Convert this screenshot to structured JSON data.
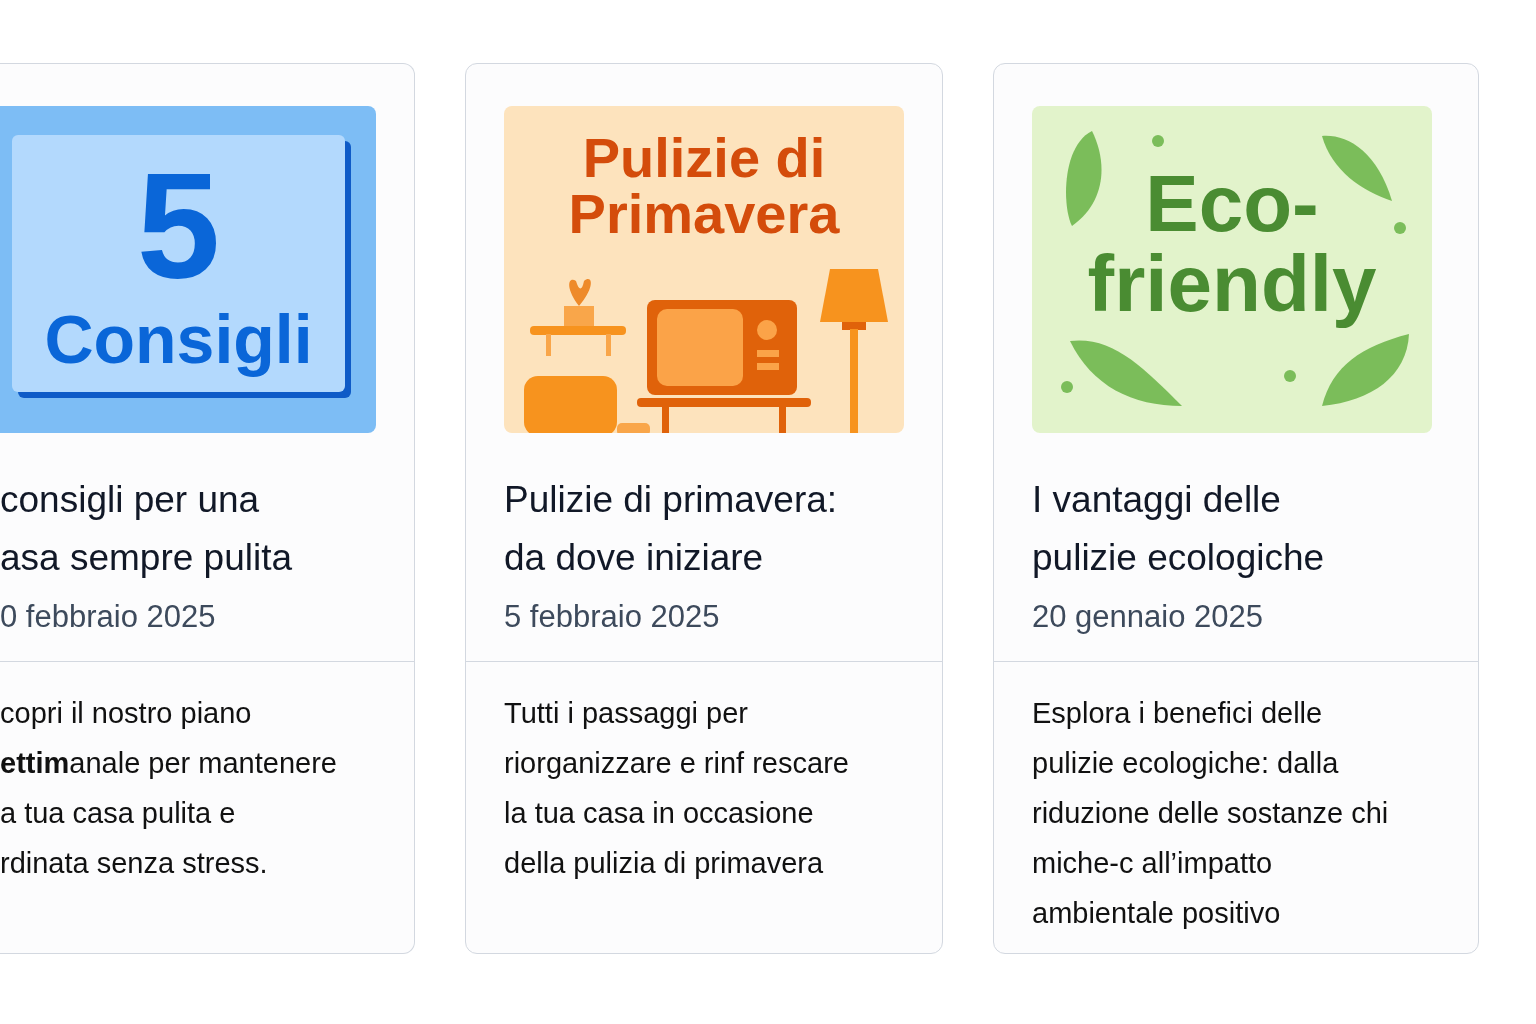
{
  "cards": [
    {
      "image": {
        "kind": "numbers",
        "text_lines": [
          "5",
          "Consigli"
        ]
      },
      "title_lines": [
        "consigli per una",
        "asa sempre pulita"
      ],
      "date": "0 febbraio 2025",
      "description_lines": [
        "copri il nostro piano",
        "**ettim**anale per mantenere",
        "a tua casa pulita e",
        "rdinata senza stress."
      ]
    },
    {
      "image": {
        "kind": "spring",
        "text_lines": [
          "Pulizie di",
          "Primavera"
        ]
      },
      "title_lines": [
        "Pulizie di primavera:",
        "da dove iniziare"
      ],
      "date": "5 febbraio 2025",
      "description_lines": [
        "Tutti i passaggi per",
        "riorganizzare e rinf rescare",
        "la tua casa in occasione",
        "della pulizia di primavera"
      ]
    },
    {
      "image": {
        "kind": "eco",
        "text_lines": [
          "Eco-",
          "friendly"
        ]
      },
      "title_lines": [
        "I vantaggi delle",
        "pulizie ecologiche"
      ],
      "date": "20 gennaio 2025",
      "description_lines": [
        "Esplora i benefici delle",
        "pulizie ecologiche: dalla",
        "riduzione delle sostanze chi",
        "miche-c all’impatto",
        "ambientale positivo"
      ]
    }
  ]
}
